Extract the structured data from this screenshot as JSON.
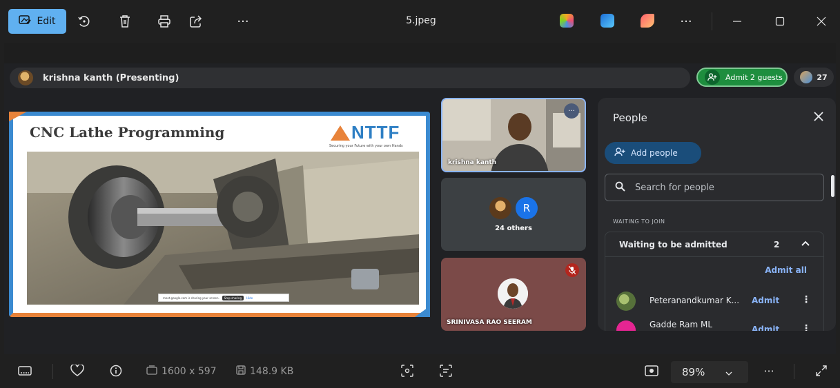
{
  "toolbar": {
    "edit_label": "Edit",
    "file_title": "5.jpeg",
    "more_label": "···"
  },
  "meet": {
    "presenter_text": "krishna kanth (Presenting)",
    "admit_guests_label": "Admit 2 guests",
    "participant_count": "27",
    "slide": {
      "title": "CNC Lathe Programming",
      "logo_text": "NTTF",
      "logo_tagline": "Securing your Future with your own Hands",
      "share_banner_text": "meet.google.com is sharing your screen.",
      "share_stop_label": "Stop sharing",
      "share_hide_label": "Hide"
    },
    "tiles": {
      "tile1_name": "krishna kanth",
      "tile2_others_label": "24 others",
      "tile2_avatar_letter": "R",
      "tile3_name": "SRINIVASA RAO SEERAM",
      "more_label": "···"
    },
    "people_panel": {
      "title": "People",
      "add_people_label": "Add people",
      "search_placeholder": "Search for people",
      "waiting_section_label": "WAITING TO JOIN",
      "waiting_title": "Waiting to be admitted",
      "waiting_count": "2",
      "admit_all_label": "Admit all",
      "guests": [
        {
          "name": "Peteranandkumar K...",
          "action": "Admit"
        },
        {
          "name": "Gadde Ram ML",
          "action": "Admit"
        }
      ]
    }
  },
  "statusbar": {
    "dimensions": "1600 x 597",
    "file_size": "148.9 KB",
    "zoom": "89%",
    "more_label": "···"
  },
  "colors": {
    "accent": "#60b0f0",
    "admit_green": "#1e8e3e",
    "link_blue": "#8ab4f8"
  }
}
